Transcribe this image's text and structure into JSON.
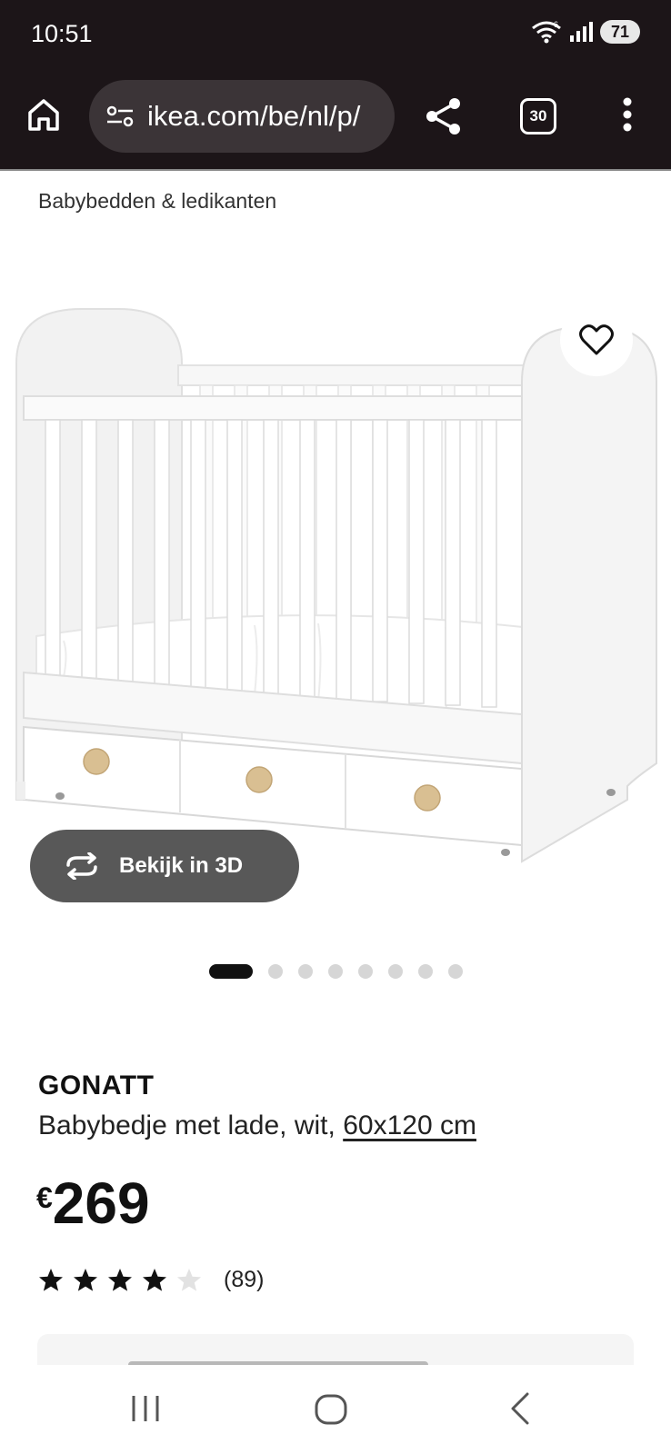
{
  "status_bar": {
    "time": "10:51",
    "network": "6",
    "battery": "71"
  },
  "browser": {
    "url": "ikea.com/be/nl/p/",
    "tab_count": "30"
  },
  "breadcrumb": "Babybedden & ledikanten",
  "gallery": {
    "view_3d_label": "Bekijk in 3D",
    "image_count": 8,
    "active_index": 0
  },
  "product": {
    "brand": "GONATT",
    "description": "Babybedje met lade, wit,",
    "size_link": "60x120 cm",
    "price_currency": "€",
    "price": "269",
    "rating": 4.5,
    "rating_max": 5,
    "review_count": "(89)"
  },
  "colors": {
    "chrome_dark": "#1c1518",
    "url_pill": "#3b3437",
    "button_3d": "#585858",
    "star": "#111111"
  }
}
